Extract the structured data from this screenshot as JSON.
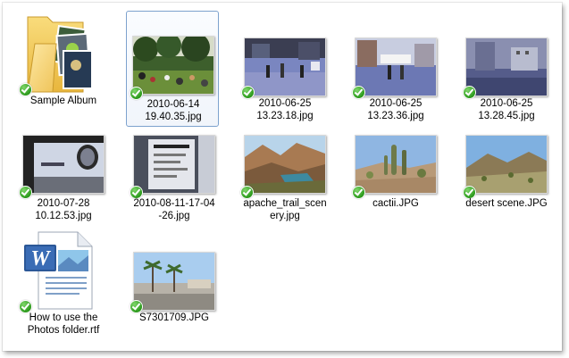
{
  "items": [
    {
      "name": "Sample Album",
      "type": "folder",
      "sync": "synced-check"
    },
    {
      "name": "2010-06-14\n19.40.35.jpg",
      "type": "photo",
      "sync": "synced-check",
      "selected": true
    },
    {
      "name": "2010-06-25\n13.23.18.jpg",
      "type": "photo",
      "sync": "synced-check"
    },
    {
      "name": "2010-06-25\n13.23.36.jpg",
      "type": "photo",
      "sync": "synced-check"
    },
    {
      "name": "2010-06-25\n13.28.45.jpg",
      "type": "photo",
      "sync": "synced-check"
    },
    {
      "name": "2010-07-28\n10.12.53.jpg",
      "type": "photo",
      "sync": "synced-check"
    },
    {
      "name": "2010-08-11-17-04\n-26.jpg",
      "type": "photo",
      "sync": "synced-check"
    },
    {
      "name": "apache_trail_scen\nery.jpg",
      "type": "photo",
      "sync": "synced-check"
    },
    {
      "name": "cactii.JPG",
      "type": "photo",
      "sync": "synced-check"
    },
    {
      "name": "desert scene.JPG",
      "type": "photo",
      "sync": "synced-check"
    },
    {
      "name": "How to use the\nPhotos folder.rtf",
      "type": "document",
      "sync": "synced-check"
    },
    {
      "name": "S7301709.JPG",
      "type": "photo",
      "sync": "synced-check"
    }
  ],
  "colors": {
    "selection_border": "#7da2ce",
    "sync_check": "#2c9a1c",
    "word_blue": "#2b5797"
  }
}
